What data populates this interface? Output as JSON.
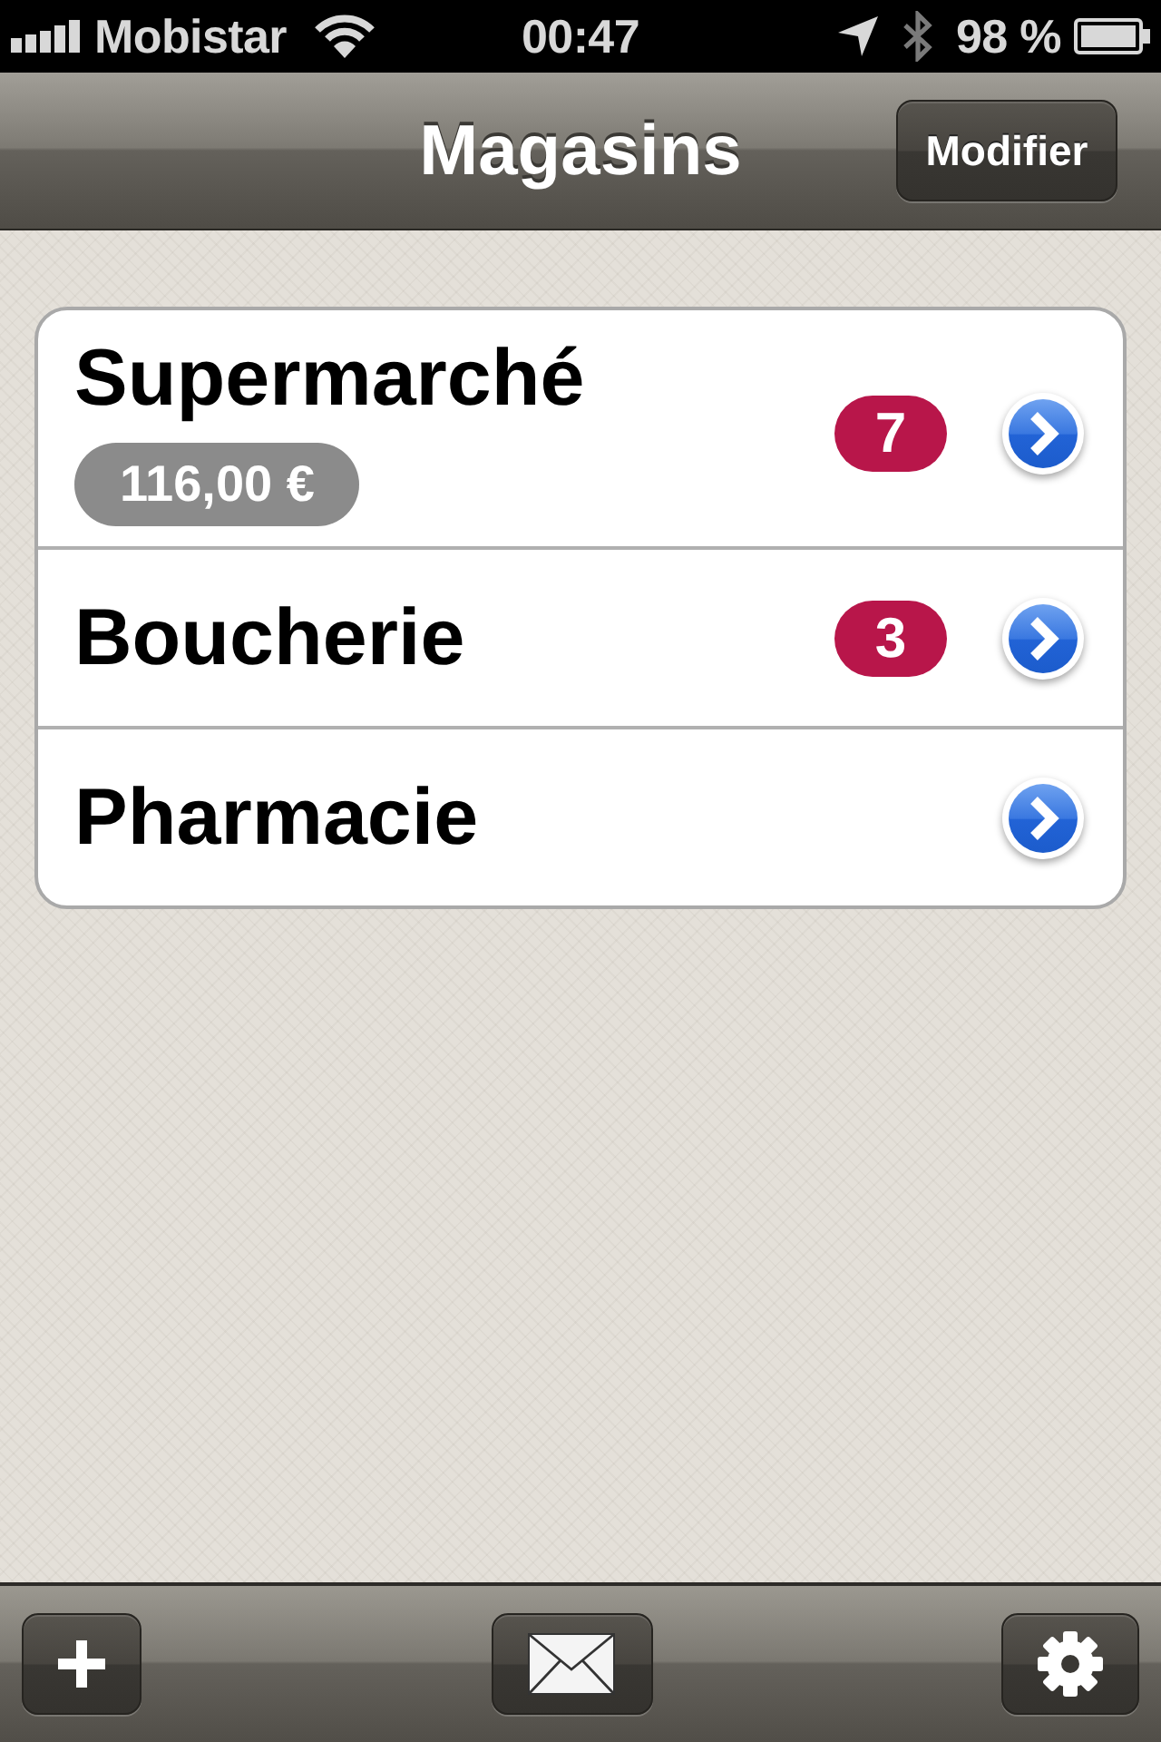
{
  "status_bar": {
    "carrier": "Mobistar",
    "time": "00:47",
    "battery": "98 %"
  },
  "nav_bar": {
    "title": "Magasins",
    "edit_button": "Modifier"
  },
  "stores": [
    {
      "name": "Supermarché",
      "total": "116,00 €",
      "count": "7"
    },
    {
      "name": "Boucherie",
      "count": "3"
    },
    {
      "name": "Pharmacie"
    }
  ]
}
